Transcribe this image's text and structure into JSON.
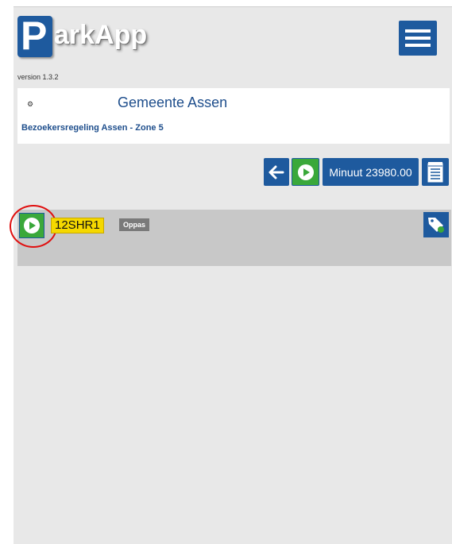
{
  "app": {
    "logo_p": "P",
    "logo_rest": "arkApp",
    "version": "version 1.3.2"
  },
  "info": {
    "icon": "gear-icon",
    "municipality": "Gemeente Assen",
    "regulation": "Bezoekersregeling Assen - Zone 5"
  },
  "toolbar": {
    "back_icon": "arrow-left-icon",
    "play_icon": "play-circle-icon",
    "minute_label": "Minuut 23980.00",
    "notes_icon": "notepad-icon"
  },
  "visitors": [
    {
      "plate": "12SHR1",
      "badge": "Oppas",
      "play_icon": "play-circle-icon",
      "tag_icon": "tag-icon"
    }
  ],
  "colors": {
    "brand_blue": "#1e5a9e",
    "play_green": "#3aa83a",
    "plate_yellow": "#f5d800",
    "badge_gray": "#7a7a7a",
    "highlight_red": "#e01010"
  }
}
